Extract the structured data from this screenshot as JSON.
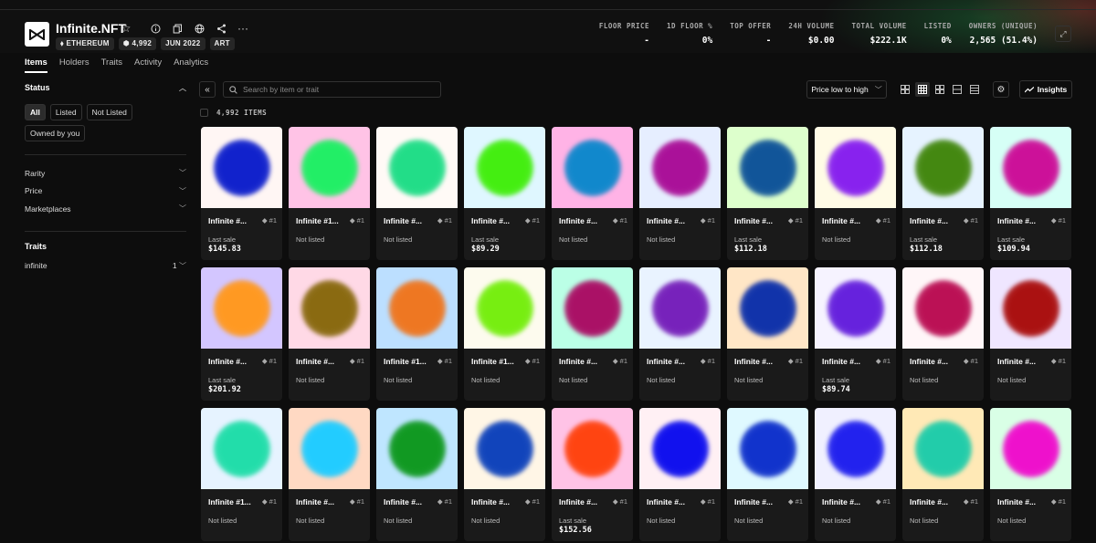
{
  "collection": {
    "title": "Infinite.NFT",
    "chips": [
      "ETHEREUM",
      "4,992",
      "JUN 2022",
      "ART"
    ],
    "icons": [
      "star-icon",
      "info-icon",
      "copy-icon",
      "globe-icon",
      "share-icon",
      "more-icon"
    ]
  },
  "stats": [
    {
      "label": "FLOOR PRICE",
      "value": "-"
    },
    {
      "label": "1D FLOOR %",
      "value": "0%"
    },
    {
      "label": "TOP OFFER",
      "value": "-"
    },
    {
      "label": "24H VOLUME",
      "value": "$0.00"
    },
    {
      "label": "TOTAL VOLUME",
      "value": "$222.1K"
    },
    {
      "label": "LISTED",
      "value": "0%"
    },
    {
      "label": "OWNERS (UNIQUE)",
      "value": "2,565 (51.4%)"
    }
  ],
  "tabs": [
    "Items",
    "Holders",
    "Traits",
    "Activity",
    "Analytics"
  ],
  "sidebar": {
    "status_title": "Status",
    "status_buttons": [
      "All",
      "Listed",
      "Not Listed",
      "Owned by you"
    ],
    "filters": [
      "Rarity",
      "Price",
      "Marketplaces"
    ],
    "traits_title": "Traits",
    "traits": [
      {
        "label": "infinite",
        "count": "1"
      }
    ]
  },
  "toolbar": {
    "search_placeholder": "Search by item or trait",
    "sort_label": "Price low to high",
    "insights_label": "Insights",
    "item_count": "4,992 ITEMS"
  },
  "items": [
    {
      "name": "Infinite #...",
      "rank": "#1",
      "status": "Last sale",
      "price": "$145.83",
      "bg": "#fff6f4",
      "orb": "#1122cc"
    },
    {
      "name": "Infinite #1...",
      "rank": "#1",
      "status": "Not listed",
      "price": "",
      "bg": "#ffc3e6",
      "orb": "#22ee66"
    },
    {
      "name": "Infinite #...",
      "rank": "#1",
      "status": "Not listed",
      "price": "",
      "bg": "#fffaf6",
      "orb": "#22dd88"
    },
    {
      "name": "Infinite #...",
      "rank": "#1",
      "status": "Last sale",
      "price": "$89.29",
      "bg": "#dff7ff",
      "orb": "#44ee11"
    },
    {
      "name": "Infinite #...",
      "rank": "#1",
      "status": "Not listed",
      "price": "",
      "bg": "#ffb3e6",
      "orb": "#1188cc"
    },
    {
      "name": "Infinite #...",
      "rank": "#1",
      "status": "Not listed",
      "price": "",
      "bg": "#e6eeff",
      "orb": "#aa1199"
    },
    {
      "name": "Infinite #...",
      "rank": "#1",
      "status": "Last sale",
      "price": "$112.18",
      "bg": "#ddffcc",
      "orb": "#115599"
    },
    {
      "name": "Infinite #...",
      "rank": "#1",
      "status": "Not listed",
      "price": "",
      "bg": "#fffbe6",
      "orb": "#8822ee"
    },
    {
      "name": "Infinite #...",
      "rank": "#1",
      "status": "Last sale",
      "price": "$112.18",
      "bg": "#e6f3ff",
      "orb": "#448811"
    },
    {
      "name": "Infinite #...",
      "rank": "#1",
      "status": "Last sale",
      "price": "$109.94",
      "bg": "#d6fff6",
      "orb": "#cc1199"
    },
    {
      "name": "Infinite #...",
      "rank": "#1",
      "status": "Last sale",
      "price": "$201.92",
      "bg": "#d3c6ff",
      "orb": "#ff9922"
    },
    {
      "name": "Infinite #...",
      "rank": "#1",
      "status": "Not listed",
      "price": "",
      "bg": "#ffd9e6",
      "orb": "#8a6a11"
    },
    {
      "name": "Infinite #1...",
      "rank": "#1",
      "status": "Not listed",
      "price": "",
      "bg": "#bcdfff",
      "orb": "#ee7722"
    },
    {
      "name": "Infinite #1...",
      "rank": "#1",
      "status": "Not listed",
      "price": "",
      "bg": "#fdfbee",
      "orb": "#77ee11"
    },
    {
      "name": "Infinite #...",
      "rank": "#1",
      "status": "Not listed",
      "price": "",
      "bg": "#bbffe6",
      "orb": "#aa1166"
    },
    {
      "name": "Infinite #...",
      "rank": "#1",
      "status": "Not listed",
      "price": "",
      "bg": "#e9f3ff",
      "orb": "#7722bb"
    },
    {
      "name": "Infinite #...",
      "rank": "#1",
      "status": "Not listed",
      "price": "",
      "bg": "#ffe6c6",
      "orb": "#1133aa"
    },
    {
      "name": "Infinite #...",
      "rank": "#1",
      "status": "Last sale",
      "price": "$89.74",
      "bg": "#f6f3ff",
      "orb": "#6622dd"
    },
    {
      "name": "Infinite #...",
      "rank": "#1",
      "status": "Not listed",
      "price": "",
      "bg": "#fff6f8",
      "orb": "#bb1155"
    },
    {
      "name": "Infinite #...",
      "rank": "#1",
      "status": "Not listed",
      "price": "",
      "bg": "#efe6ff",
      "orb": "#aa1111"
    },
    {
      "name": "Infinite #1...",
      "rank": "#1",
      "status": "Not listed",
      "price": "",
      "bg": "#e6f3ff",
      "orb": "#22ddaa"
    },
    {
      "name": "Infinite #...",
      "rank": "#1",
      "status": "Not listed",
      "price": "",
      "bg": "#ffd9c3",
      "orb": "#22ccff"
    },
    {
      "name": "Infinite #...",
      "rank": "#1",
      "status": "Not listed",
      "price": "",
      "bg": "#bfe6ff",
      "orb": "#119922"
    },
    {
      "name": "Infinite #...",
      "rank": "#1",
      "status": "Not listed",
      "price": "",
      "bg": "#fff6e6",
      "orb": "#1144bb"
    },
    {
      "name": "Infinite #...",
      "rank": "#1",
      "status": "Last sale",
      "price": "$152.56",
      "bg": "#ffc3e6",
      "orb": "#ff4411"
    },
    {
      "name": "Infinite #...",
      "rank": "#1",
      "status": "Not listed",
      "price": "",
      "bg": "#fff0f4",
      "orb": "#1111ee"
    },
    {
      "name": "Infinite #...",
      "rank": "#1",
      "status": "Not listed",
      "price": "",
      "bg": "#dff9ff",
      "orb": "#1133cc"
    },
    {
      "name": "Infinite #...",
      "rank": "#1",
      "status": "Not listed",
      "price": "",
      "bg": "#f0f0ff",
      "orb": "#2222ee"
    },
    {
      "name": "Infinite #...",
      "rank": "#1",
      "status": "Not listed",
      "price": "",
      "bg": "#ffe9b6",
      "orb": "#22ccaa"
    },
    {
      "name": "Infinite #...",
      "rank": "#1",
      "status": "Not listed",
      "price": "",
      "bg": "#d9ffe6",
      "orb": "#ee11cc"
    }
  ]
}
